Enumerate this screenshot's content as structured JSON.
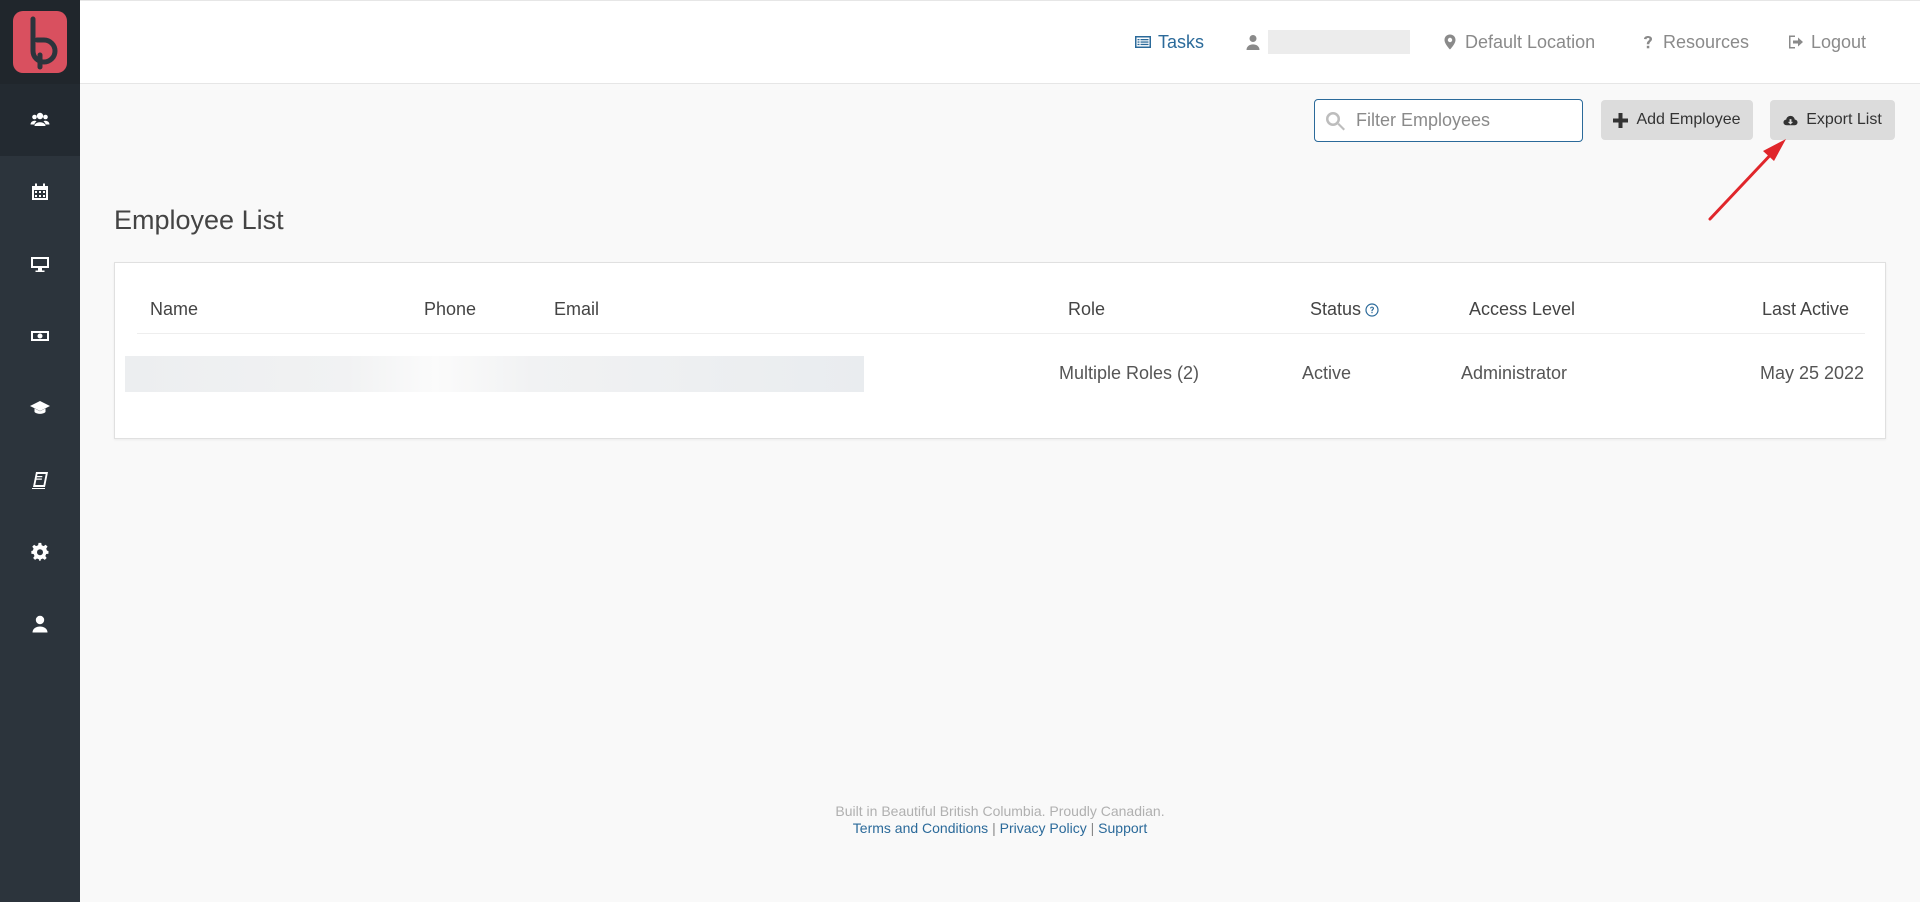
{
  "topbar": {
    "tasks_label": "Tasks",
    "location_label": "Default Location",
    "resources_label": "Resources",
    "logout_label": "Logout"
  },
  "sidebar": {
    "items": [
      {
        "icon": "users-icon",
        "active": true
      },
      {
        "icon": "calendar-icon"
      },
      {
        "icon": "monitor-icon"
      },
      {
        "icon": "money-icon"
      },
      {
        "icon": "graduation-cap-icon"
      },
      {
        "icon": "book-icon"
      },
      {
        "icon": "gear-icon"
      },
      {
        "icon": "user-icon"
      }
    ]
  },
  "controls": {
    "filter_placeholder": "Filter Employees",
    "add_label": "Add Employee",
    "export_label": "Export List"
  },
  "page": {
    "title": "Employee List"
  },
  "table": {
    "columns": [
      "Name",
      "Phone",
      "Email",
      "Role",
      "Status",
      "Access Level",
      "Last Active"
    ],
    "rows": [
      {
        "name": "",
        "phone": "",
        "email": "",
        "role": "Multiple Roles (2)",
        "status": "Active",
        "access_level": "Administrator",
        "last_active": "May 25 2022"
      }
    ]
  },
  "footer": {
    "tagline": "Built in Beautiful British Columbia. Proudly Canadian.",
    "terms": "Terms and Conditions",
    "privacy": "Privacy Policy",
    "support": "Support",
    "separator": "|"
  },
  "colors": {
    "sidebar_bg": "#2c343c",
    "brand": "#d9505f",
    "link": "#2b6a9a",
    "annotation": "#e0262b"
  }
}
